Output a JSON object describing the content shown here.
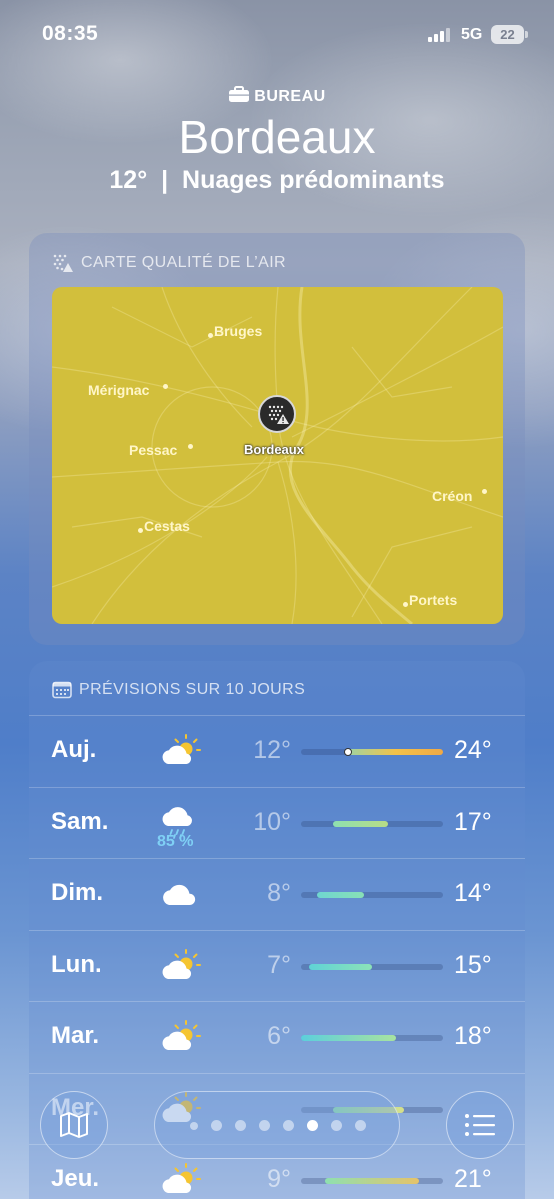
{
  "status_bar": {
    "time": "08:35",
    "network": "5G",
    "battery": "22"
  },
  "location": {
    "tag": "BUREAU",
    "city": "Bordeaux",
    "temperature": "12°",
    "separator": "|",
    "condition": "Nuages prédominants"
  },
  "air_quality": {
    "title": "CARTE QUALITÉ DE L’AIR",
    "map_color": "#d2bf3c",
    "places": [
      "Bruges",
      "Mérignac",
      "Pessac",
      "Cestas",
      "Créon",
      "Portets"
    ],
    "pin_label": "Bordeaux"
  },
  "forecast": {
    "title": "PRÉVISIONS SUR 10 JOURS",
    "range_min": 6,
    "range_max": 24,
    "days": [
      {
        "day": "Auj.",
        "icon": "partly-sunny-icon",
        "low": "12°",
        "high": "24°",
        "precip": "",
        "lo_val": 12,
        "hi_val": 24,
        "current": 12,
        "colors": [
          "#9ed3a2",
          "#f3c24a",
          "#f0a945"
        ]
      },
      {
        "day": "Sam.",
        "icon": "rain-icon",
        "low": "10°",
        "high": "17°",
        "precip": "85 %",
        "lo_val": 10,
        "hi_val": 17,
        "colors": [
          "#8ee0b0",
          "#b7dc86"
        ]
      },
      {
        "day": "Dim.",
        "icon": "cloud-icon",
        "low": "8°",
        "high": "14°",
        "precip": "",
        "lo_val": 8,
        "hi_val": 14,
        "colors": [
          "#6fd6d0",
          "#88e0b6"
        ]
      },
      {
        "day": "Lun.",
        "icon": "partly-sunny-icon",
        "low": "7°",
        "high": "15°",
        "precip": "",
        "lo_val": 7,
        "hi_val": 15,
        "colors": [
          "#5fd3d6",
          "#8ce2b8"
        ]
      },
      {
        "day": "Mar.",
        "icon": "partly-sunny-icon",
        "low": "6°",
        "high": "18°",
        "precip": "",
        "lo_val": 6,
        "hi_val": 18,
        "colors": [
          "#5ccfdc",
          "#a8e3a0"
        ]
      },
      {
        "day": "Mer.",
        "icon": "partly-sunny-icon",
        "low": "",
        "high": "",
        "precip": "",
        "lo_val": 10,
        "hi_val": 19,
        "colors": [
          "#8ee0b0",
          "#d7e08a"
        ]
      },
      {
        "day": "Jeu.",
        "icon": "partly-sunny-icon",
        "low": "9°",
        "high": "21°",
        "precip": "",
        "lo_val": 9,
        "hi_val": 21,
        "colors": [
          "#8ee0b0",
          "#e5c36a"
        ]
      }
    ]
  },
  "pager": {
    "count": 8,
    "active_index": 5
  }
}
